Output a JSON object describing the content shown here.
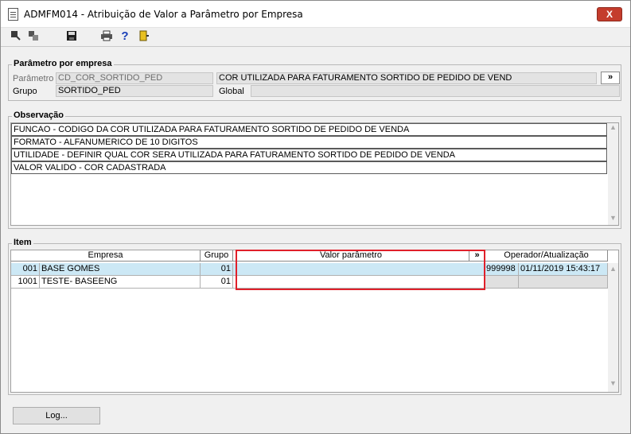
{
  "window": {
    "title": "ADMFM014 - Atribuição de Valor a Parâmetro por Empresa",
    "close_label": "X"
  },
  "toolbar": {
    "icons": [
      "first-record-icon",
      "copy-icon",
      "save-icon",
      "print-icon",
      "help-icon",
      "exit-icon"
    ],
    "help_glyph": "?"
  },
  "parametro_group": {
    "title": "Parâmetro por empresa",
    "parametro_label": "Parâmetro",
    "parametro_value": "CD_COR_SORTIDO_PED",
    "parametro_desc": "COR UTILIZADA PARA FATURAMENTO SORTIDO DE PEDIDO DE VEND",
    "more_label": "»",
    "grupo_label": "Grupo",
    "grupo_value": "SORTIDO_PED",
    "global_label": "Global",
    "global_value": ""
  },
  "observacao": {
    "title": "Observação",
    "lines": [
      "FUNCAO - CODIGO DA COR UTILIZADA PARA FATURAMENTO SORTIDO DE PEDIDO DE VENDA",
      "FORMATO - ALFANUMERICO DE 10 DIGITOS",
      "UTILIDADE - DEFINIR QUAL COR SERA UTILIZADA PARA FATURAMENTO SORTIDO DE PEDIDO DE VENDA",
      "VALOR VALIDO - COR CADASTRADA"
    ]
  },
  "item": {
    "title": "Item",
    "headers": {
      "empresa": "Empresa",
      "grupo": "Grupo",
      "valor": "Valor parâmetro",
      "more": "»",
      "operador": "Operador/Atualização"
    },
    "rows": [
      {
        "codigo": "001",
        "nome": "BASE GOMES",
        "grupo": "01",
        "valor": "",
        "operador": "999998",
        "atualizacao": "01/11/2019 15:43:17"
      },
      {
        "codigo": "1001",
        "nome": "TESTE- BASEENG",
        "grupo": "01",
        "valor": "",
        "operador": "",
        "atualizacao": ""
      }
    ]
  },
  "footer": {
    "log_label": "Log..."
  },
  "colors": {
    "selected_row": "#cce8f5",
    "highlight": "#e0202a",
    "close_button": "#c43c2c"
  }
}
